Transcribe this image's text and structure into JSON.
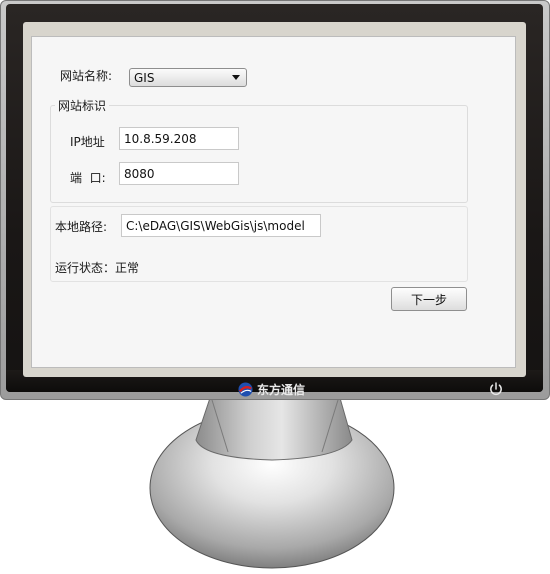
{
  "brand": {
    "name": "东方通信",
    "logo_icon": "brand-logo-icon"
  },
  "form": {
    "site_name": {
      "label": "网站名称:",
      "selected": "GIS"
    },
    "site_id_group": {
      "title": "网站标识",
      "ip_label": "IP地址",
      "ip_value": "10.8.59.208",
      "port_label": "端  口:",
      "port_value": "8080"
    },
    "local_path": {
      "label": "本地路径:",
      "value": "C:\\eDAG\\GIS\\WebGis\\js\\model"
    },
    "status": {
      "text": "运行状态：正常"
    },
    "next_button": "下一步"
  },
  "colors": {
    "bezel": "#1a1716",
    "screen": "#f6f6f6",
    "stand": "#9a9a9a"
  }
}
